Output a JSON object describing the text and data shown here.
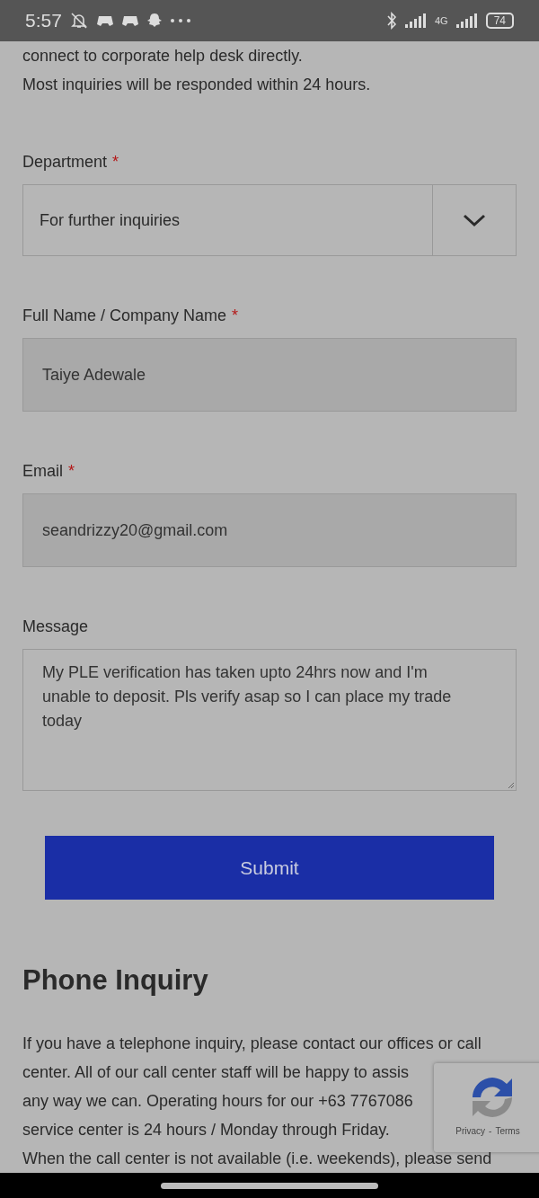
{
  "status_bar": {
    "time": "5:57",
    "network": "4G",
    "battery": "74"
  },
  "intro": [
    "connect to corporate help desk directly.",
    "Most inquiries will be responded within 24 hours."
  ],
  "form": {
    "fields": [
      {
        "kind": "select",
        "label": "Department",
        "required_mark": "*",
        "value": "For further inquiries"
      },
      {
        "kind": "input",
        "label": "Full Name / Company Name",
        "required_mark": "*",
        "value": "Taiye  Adewale"
      },
      {
        "kind": "input",
        "label": "Email",
        "required_mark": "*",
        "value": "seandrizzy20@gmail.com"
      },
      {
        "kind": "textarea",
        "label": "Message",
        "value": "My PLE verification has taken upto 24hrs now and I'm unable to deposit. Pls verify asap so I can place my trade today"
      }
    ],
    "submit": "Submit"
  },
  "phone_section": {
    "heading": "Phone Inquiry",
    "lines": [
      "If you have a telephone inquiry, please contact our offices or call",
      "center. All of our call center staff will be happy to assis",
      "any way we can. Operating hours for our +63 7767086",
      "service center is 24 hours / Monday through Friday.",
      "When the call center is not available (i.e. weekends), please send"
    ]
  },
  "recaptcha": {
    "privacy": "Privacy",
    "separator": "-",
    "terms": "Terms"
  }
}
